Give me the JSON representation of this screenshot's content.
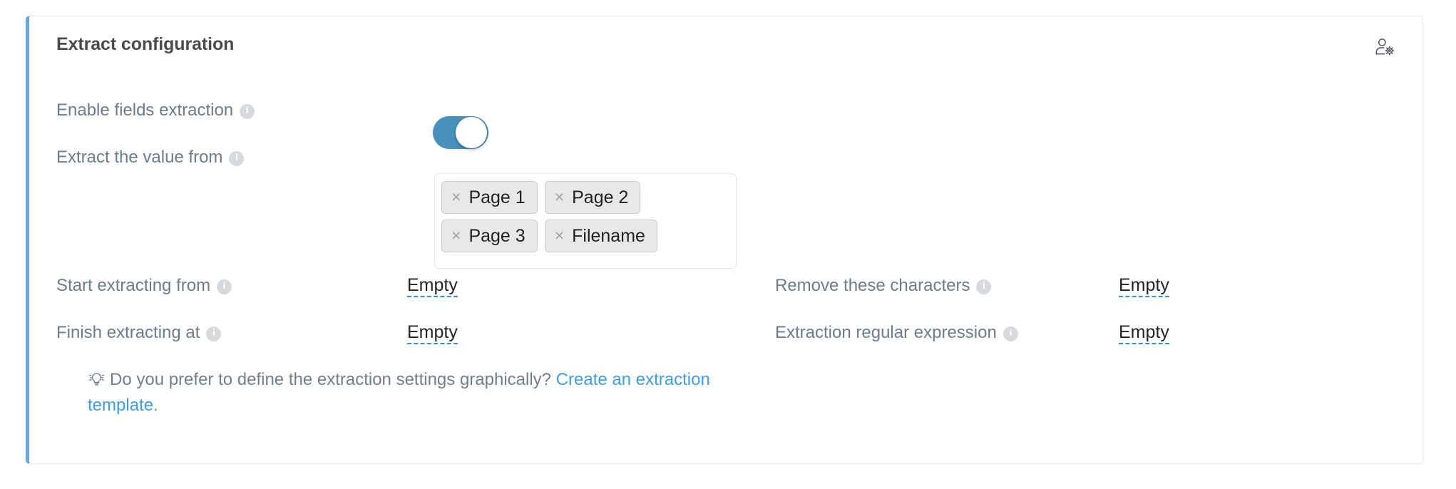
{
  "card": {
    "title": "Extract configuration",
    "accent_color": "#6ea4e0",
    "user_settings_icon": "user-gear-icon"
  },
  "rows": {
    "enable_fields_extraction": {
      "label": "Enable fields extraction",
      "info": "i",
      "toggle_state": "on",
      "toggle_color": "#4891bd"
    },
    "extract_value_from": {
      "label": "Extract the value from",
      "info": "i",
      "tags": [
        {
          "label": "Page 1",
          "remove": "×"
        },
        {
          "label": "Page 2",
          "remove": "×"
        },
        {
          "label": "Page 3",
          "remove": "×"
        },
        {
          "label": "Filename",
          "remove": "×"
        }
      ]
    },
    "start_extracting_from": {
      "label": "Start extracting from",
      "info": "i",
      "value": "Empty"
    },
    "finish_extracting_at": {
      "label": "Finish extracting at",
      "info": "i",
      "value": "Empty"
    },
    "remove_these_characters": {
      "label": "Remove these characters",
      "info": "i",
      "value": "Empty"
    },
    "extraction_regular_expression": {
      "label": "Extraction regular expression",
      "info": "i",
      "value": "Empty"
    }
  },
  "hint": {
    "icon": "lightbulb-icon",
    "text": "Do you prefer to define the extraction settings graphically? ",
    "link": "Create an extraction template.",
    "link_color": "#3e9ede"
  }
}
